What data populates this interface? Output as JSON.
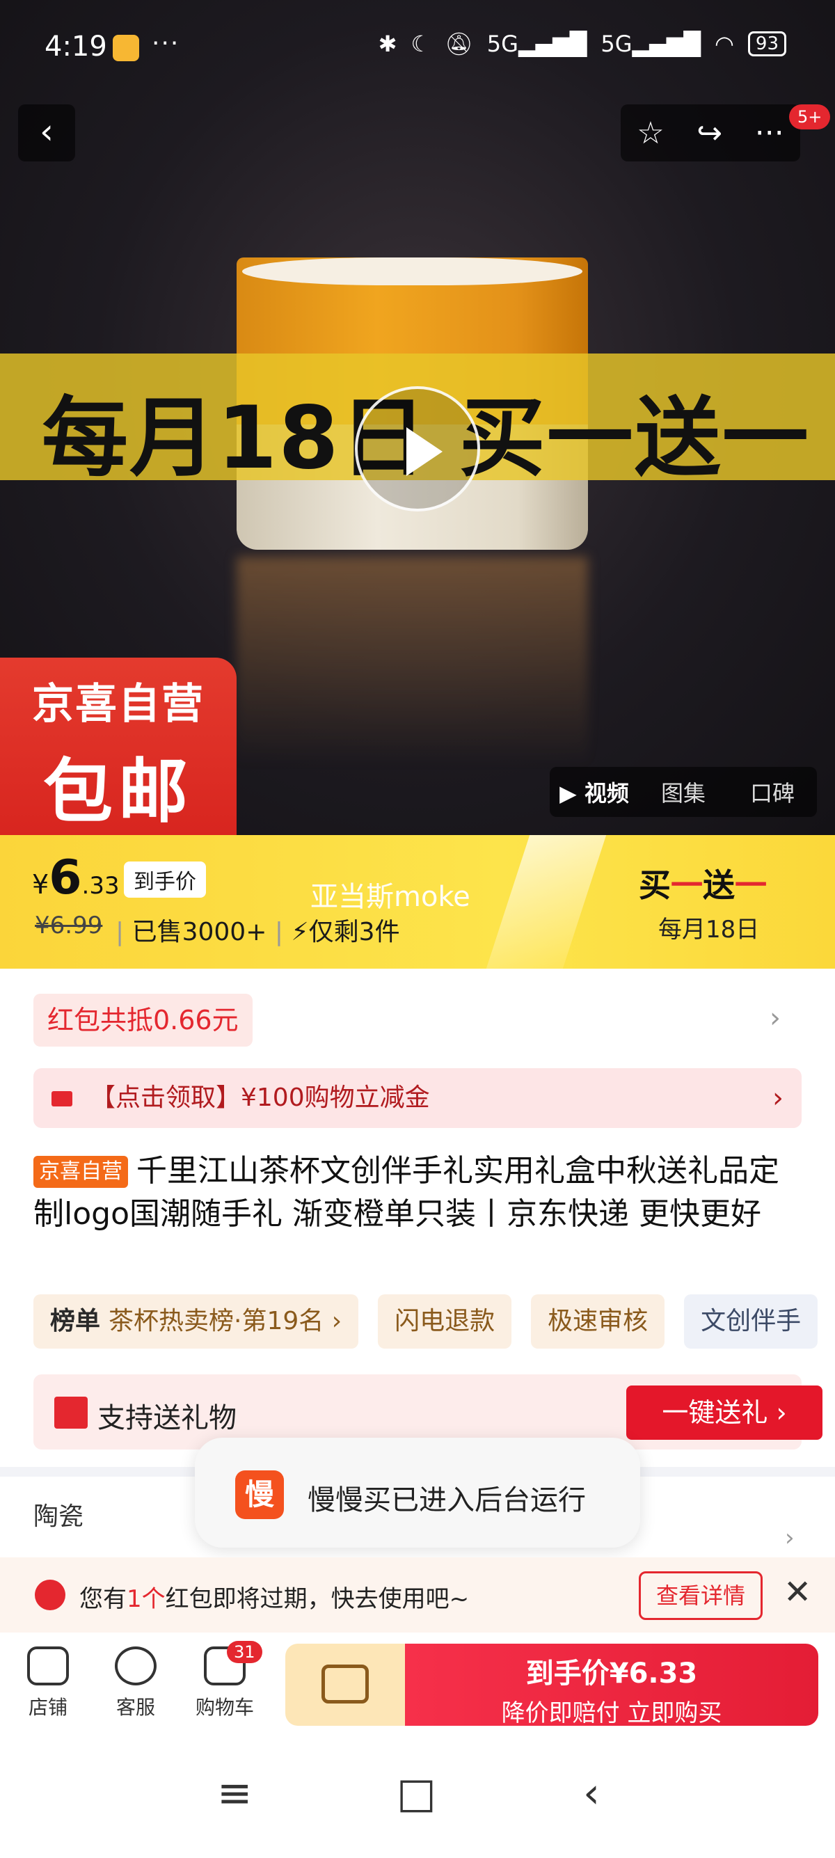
{
  "status_bar": {
    "time": "4:19",
    "dots": "···",
    "icons": [
      "bluetooth-icon",
      "moon-icon",
      "mute-icon",
      "signal-5g-icon",
      "signal-5g-icon",
      "wifi-icon"
    ],
    "battery": "93"
  },
  "hero": {
    "promo_text": "每月18日 买一送一",
    "badge_count": "5+",
    "jd_corner_line1": "京喜自营",
    "jd_corner_line2": "包邮",
    "media_tabs": [
      "▶ 视频",
      "图集",
      "口碑"
    ]
  },
  "price": {
    "currency": "¥",
    "integer": "6",
    "decimal": ".33",
    "tag": "到手价",
    "original": "¥6.99",
    "sold": "已售3000+",
    "stock": "仅剩3件",
    "watermark": "亚当斯moke",
    "promo_a": "买",
    "promo_b": "一",
    "promo_c": "送",
    "promo_d": "一",
    "promo_sub": "每月18日"
  },
  "coupon": {
    "text": "红包共抵0.66元"
  },
  "claim": {
    "text": "【点击领取】¥100购物立减金"
  },
  "product": {
    "tag": "京喜自营",
    "title": "千里江山茶杯文创伴手礼实用礼盒中秋送礼品定制logo国潮随手礼 渐变橙单只装丨京东快递 更快更好"
  },
  "tags": {
    "rank_label": "榜单",
    "rank_text": "茶杯热卖榜·第19名 ›",
    "refund": "闪电退款",
    "review": "极速审核",
    "more": "文创伴手"
  },
  "gift": {
    "label": "支持送礼物",
    "button": "一键送礼 ›"
  },
  "specs": {
    "material": "陶瓷"
  },
  "toast": {
    "logo": "慢",
    "message": "慢慢买已进入后台运行"
  },
  "expire": {
    "prefix": "您有",
    "count": "1个",
    "suffix": "红包即将过期，快去使用吧~",
    "detail_button": "查看详情"
  },
  "bottom_nav": {
    "shop": "店铺",
    "service": "客服",
    "cart": "购物车",
    "cart_count": "31",
    "buy_line1": "到手价¥6.33",
    "buy_line2": "降价即赔付 立即购买"
  },
  "colors": {
    "accent_red": "#e4272f",
    "banner_yellow": "#fbd53a"
  }
}
